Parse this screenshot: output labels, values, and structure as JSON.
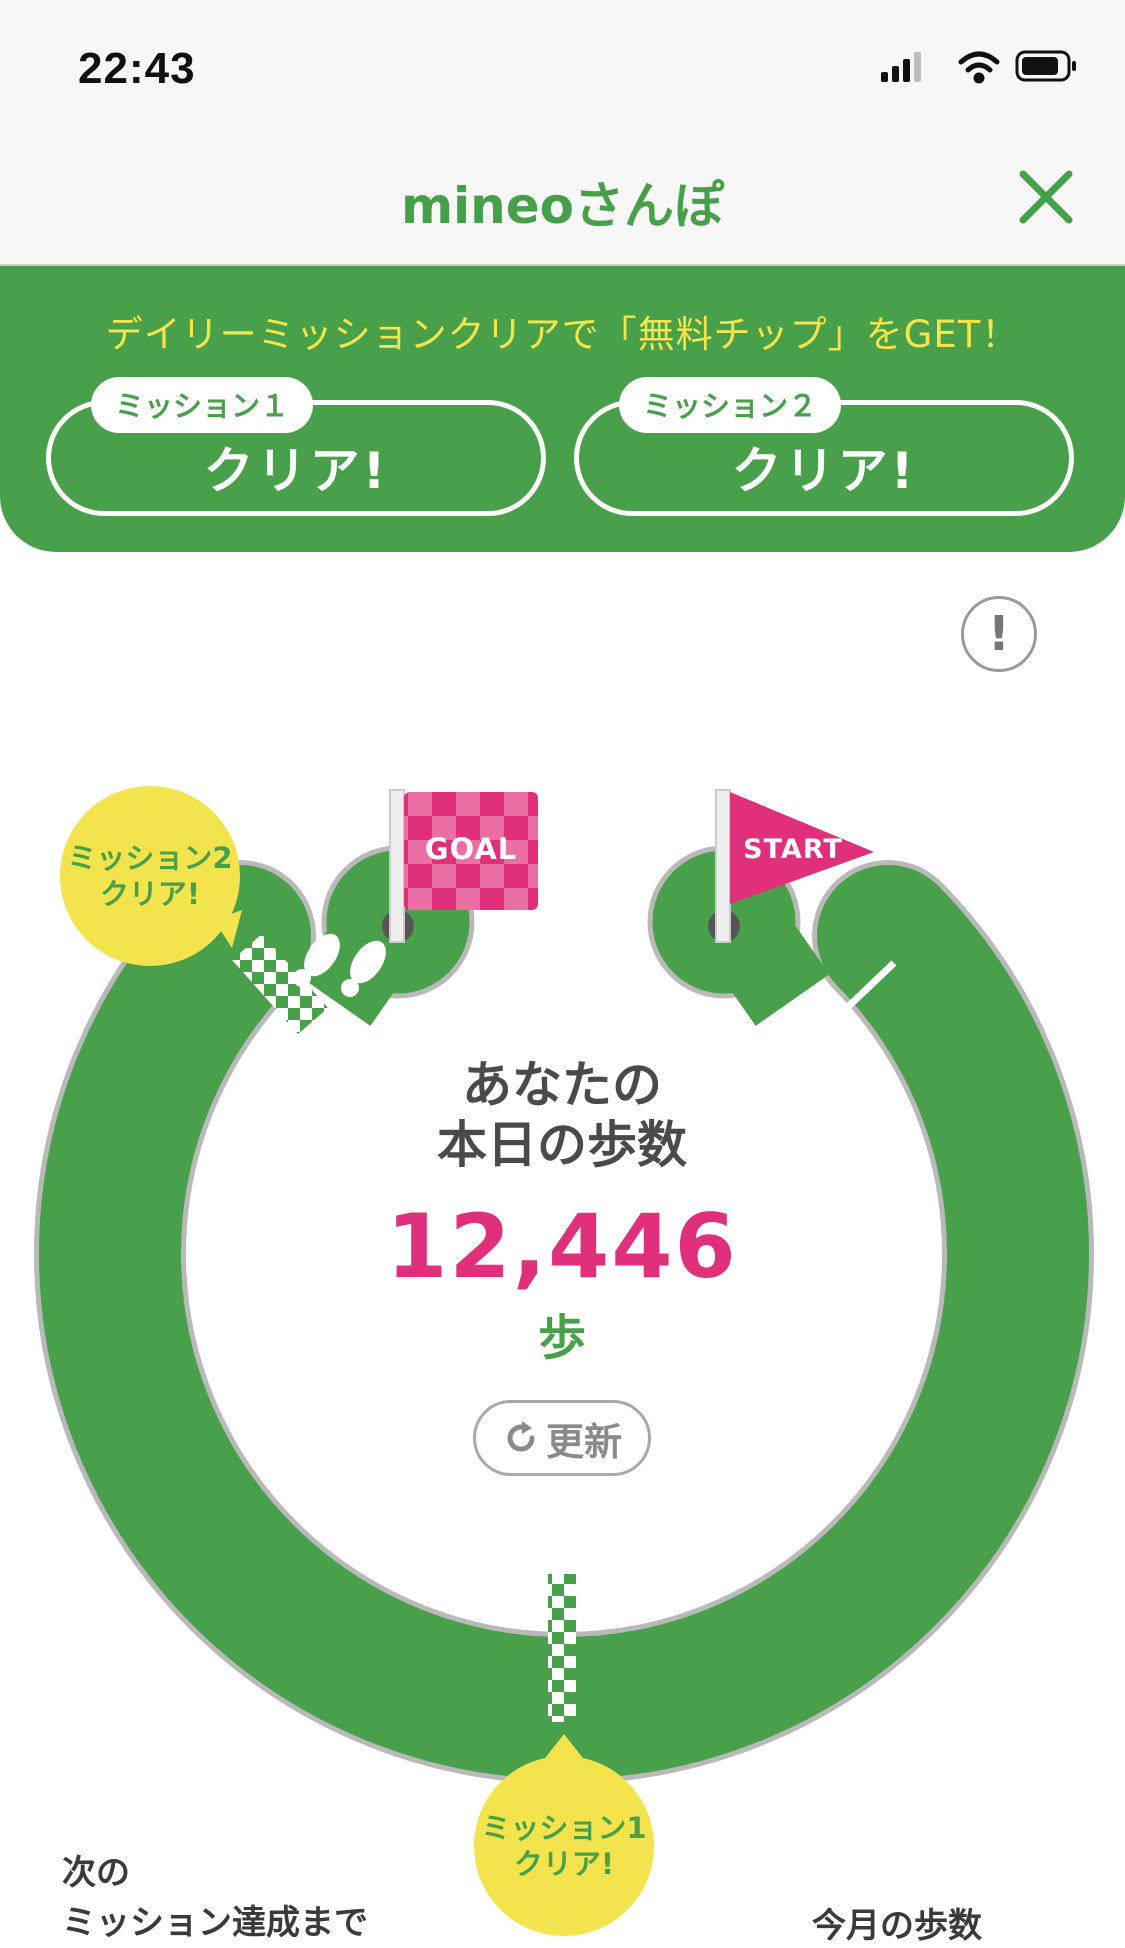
{
  "status_bar": {
    "time": "22:43"
  },
  "nav": {
    "title": "mineoさんぽ"
  },
  "banner": {
    "text": "デイリーミッションクリアで「無料チップ」をGET！",
    "missions": [
      {
        "tag": "ミッション１",
        "status": "クリア!"
      },
      {
        "tag": "ミッション２",
        "status": "クリア!"
      }
    ]
  },
  "track": {
    "goal_label": "GOAL",
    "start_label": "START",
    "bubble_mission2": {
      "line1": "ミッション2",
      "line2": "クリア!"
    },
    "bubble_mission1": {
      "line1": "ミッション1",
      "line2": "クリア!"
    }
  },
  "steps": {
    "heading_line1": "あなたの",
    "heading_line2": "本日の歩数",
    "value": "12,446",
    "unit": "歩",
    "refresh_label": "更新"
  },
  "footer": {
    "next_line1": "次の",
    "next_line2": "ミッション達成まで",
    "monthly": "今月の歩数"
  },
  "colors": {
    "green": "#49a04b",
    "pink": "#e0307c",
    "yellow": "#f3e34c"
  }
}
